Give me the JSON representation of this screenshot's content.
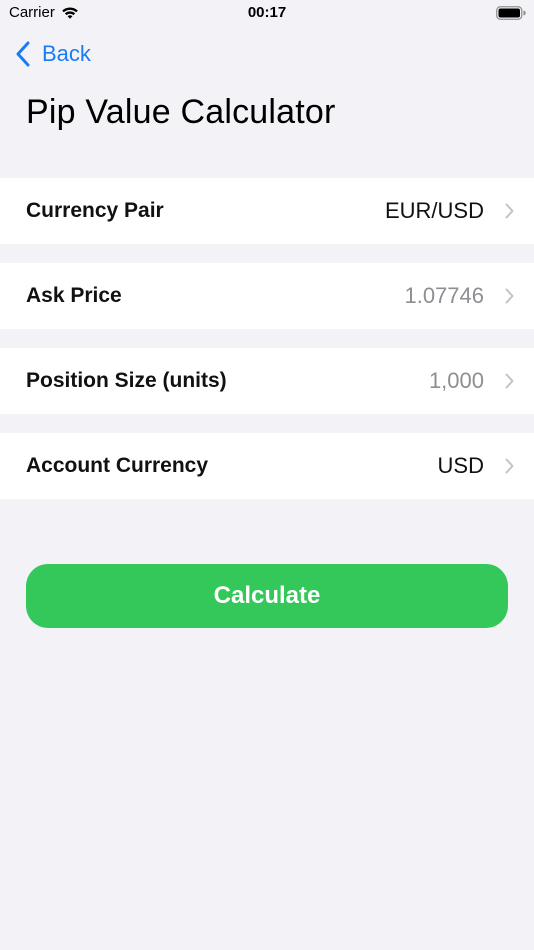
{
  "status_bar": {
    "carrier": "Carrier",
    "time": "00:17",
    "wifi_icon": "wifi-icon",
    "battery_icon": "battery-icon"
  },
  "nav": {
    "back_label": "Back",
    "back_icon": "chevron-left-icon"
  },
  "page": {
    "title": "Pip Value Calculator"
  },
  "rows": [
    {
      "label": "Currency Pair",
      "value": "EUR/USD"
    },
    {
      "label": "Ask Price",
      "value": "1.07746"
    },
    {
      "label": "Position Size (units)",
      "value": "1,000"
    },
    {
      "label": "Account Currency",
      "value": "USD"
    }
  ],
  "actions": {
    "calculate_label": "Calculate"
  },
  "colors": {
    "accent": "#1a7cf5",
    "button_green": "#34c759",
    "background": "#f2f2f7",
    "muted_text": "#8e8e93"
  }
}
